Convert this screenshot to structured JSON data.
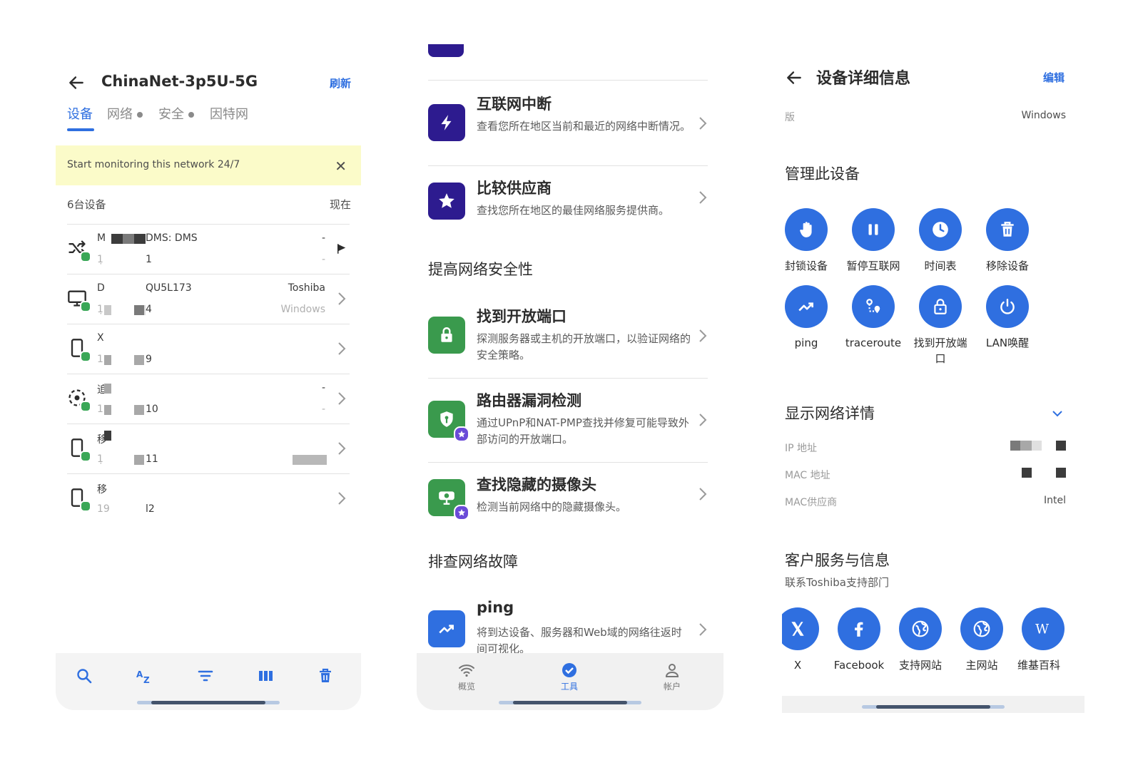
{
  "panel1": {
    "title": "ChinaNet-3p5U-5G",
    "refresh": "刷新",
    "tabs": [
      "设备",
      "网络",
      "安全",
      "因特网"
    ],
    "banner": "Start monitoring this network 24/7",
    "count": "6台设备",
    "time": "现在",
    "devices": [
      {
        "name": "M",
        "model": "DMS: DMS",
        "ip": "1̣",
        "suffix": "1",
        "vendor": "-",
        "os": "-",
        "icon": "shuffle-icon",
        "action": "flag-icon"
      },
      {
        "name": "D",
        "model": "QU5L173",
        "ip": "1̣",
        "suffix": "4",
        "vendor": "Toshiba",
        "os": "Windows",
        "icon": "monitor-icon",
        "action": "chevron-right-icon"
      },
      {
        "name": "X",
        "model": "",
        "ip": "1",
        "suffix": "9",
        "vendor": "",
        "os": "",
        "icon": "phone-icon",
        "action": "chevron-right-icon"
      },
      {
        "name": "追",
        "model": "",
        "ip": "1",
        "suffix": "10",
        "vendor": "-",
        "os": "-",
        "icon": "camera-ring-icon",
        "action": "chevron-right-icon"
      },
      {
        "name": "移",
        "model": "",
        "ip": "1̣",
        "suffix": "11",
        "vendor": "",
        "os": "",
        "icon": "phone-icon",
        "action": "chevron-right-icon"
      },
      {
        "name": "移",
        "model": "",
        "ip": "19",
        "suffix": "l2",
        "vendor": "",
        "os": "",
        "icon": "phone-icon",
        "action": "chevron-right-icon"
      }
    ],
    "toolbar": [
      "search-icon",
      "sort-az-icon",
      "filter-icon",
      "columns-icon",
      "trash-icon"
    ]
  },
  "panel2": {
    "tools": [
      {
        "title": "互联网中断",
        "desc": "查看您所在地区当前和最近的网络中断情况。",
        "icon": "lightning-icon",
        "color": "#2d1b8f",
        "premium": false
      },
      {
        "title": "比较供应商",
        "desc": "查找您所在地区的最佳网络服务提供商。",
        "icon": "star-icon",
        "color": "#2d1b8f",
        "premium": false
      },
      {
        "title": "找到开放端口",
        "desc": "探测服务器或主机的开放端口，以验证网络的安全策略。",
        "icon": "lock-icon",
        "color": "#3a9a4d",
        "premium": false
      },
      {
        "title": "路由器漏洞检测",
        "desc": "通过UPnP和NAT-PMP查找并修复可能导致外部访问的开放端口。",
        "icon": "shield-icon",
        "color": "#3a9a4d",
        "premium": true
      },
      {
        "title": "查找隐藏的摄像头",
        "desc": "检测当前网络中的隐藏摄像头。",
        "icon": "camera-icon",
        "color": "#3a9a4d",
        "premium": true
      },
      {
        "title": "ping",
        "desc": "将到达设备、服务器和Web域的网络往返时间可视化。",
        "icon": "trend-icon",
        "color": "#2f6fe0",
        "premium": false
      }
    ],
    "sections": [
      "提高网络安全性",
      "排查网络故障"
    ],
    "tabbar": [
      {
        "label": "概览",
        "icon": "wifi-icon"
      },
      {
        "label": "工具",
        "icon": "check-circle-icon"
      },
      {
        "label": "帐户",
        "icon": "person-icon"
      }
    ]
  },
  "panel3": {
    "title": "设备详细信息",
    "edit": "编辑",
    "version_label": "版",
    "version_value": "Windows",
    "manage_title": "管理此设备",
    "actions": [
      {
        "label": "封锁设备",
        "icon": "hand-icon"
      },
      {
        "label": "暂停互联网",
        "icon": "pause-icon"
      },
      {
        "label": "时间表",
        "icon": "clock-icon"
      },
      {
        "label": "移除设备",
        "icon": "trash-icon"
      },
      {
        "label": "ping",
        "icon": "trend-icon"
      },
      {
        "label": "traceroute",
        "icon": "route-icon"
      },
      {
        "label": "找到开放端口",
        "icon": "lock-icon"
      },
      {
        "label": "LAN唤醒",
        "icon": "power-icon"
      }
    ],
    "network_title": "显示网络详情",
    "network_rows": [
      {
        "label": "IP 地址",
        "value": ""
      },
      {
        "label": "MAC 地址",
        "value": ""
      },
      {
        "label": "MAC供应商",
        "value": "Intel"
      }
    ],
    "support_title": "客户服务与信息",
    "support_sub": "联系Toshiba支持部门",
    "support_links": [
      {
        "label": "X",
        "icon": "x-logo-icon"
      },
      {
        "label": "Facebook",
        "icon": "facebook-icon"
      },
      {
        "label": "支持网站",
        "icon": "globe-icon"
      },
      {
        "label": "主网站",
        "icon": "globe-icon"
      },
      {
        "label": "维基百科",
        "icon": "wikipedia-icon"
      }
    ]
  },
  "colors": {
    "accent": "#2f6fe0",
    "online": "#3aa757",
    "banner": "#fbfbc9",
    "deep_purple": "#2d1b8f",
    "green": "#3a9a4d"
  }
}
